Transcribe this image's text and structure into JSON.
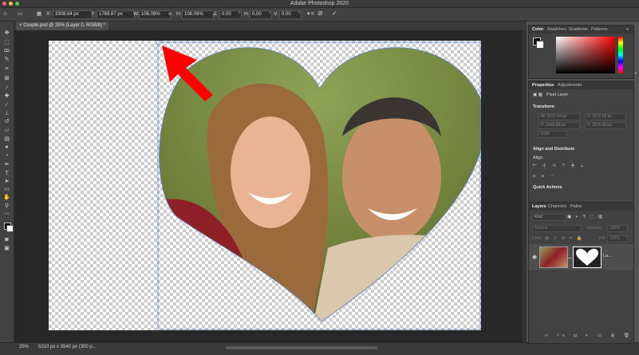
{
  "app": {
    "title": "Adobe Photoshop 2020"
  },
  "options_bar": {
    "x_label": "X:",
    "x_value": "3308.64 px",
    "y_label": "Y:",
    "y_value": "1769.87 px",
    "w_label": "W:",
    "w_value": "106.09%",
    "h_label": "H:",
    "h_value": "106.09%",
    "angle_value": "0.00",
    "hskew_label": "H:",
    "hskew_value": "0.00",
    "vskew_label": "V:",
    "vskew_value": "0.00",
    "degree_sym": "°",
    "cancel_glyph": "⊘",
    "commit_glyph": "✓"
  },
  "document_tab": {
    "label": "Couple.psd @ 25% (Layer 0, RGB/8) *",
    "close_glyph": "×"
  },
  "status_bar": {
    "zoom": "25%",
    "doc_info": "5310 px x 3540 px (300 p..."
  },
  "color_panel": {
    "tabs": [
      "Color",
      "Swatches",
      "Gradients",
      "Patterns"
    ],
    "foreground_color": "#000000",
    "background_color": "#ffffff"
  },
  "properties_panel": {
    "tabs": [
      "Properties",
      "Adjustments"
    ],
    "layer_type": "Pixel Layer",
    "transform_heading": "Transform",
    "w_placeholder": "W: 2372.94 px",
    "x_placeholder": "X: 3072.58 px",
    "h_placeholder": "H: 1649.80 px",
    "y_placeholder": "Y: 1574.49 px",
    "angle_placeholder": "0.00°",
    "align_heading": "Align and Distribute",
    "align_label": "Align:",
    "quick_actions_heading": "Quick Actions"
  },
  "layers_panel": {
    "tabs": [
      "Layers",
      "Channels",
      "Paths"
    ],
    "filter_label": "Kind",
    "blend_mode": "Normal",
    "opacity_label": "Opacity:",
    "opacity_value": "100%",
    "lock_label": "Lock:",
    "fill_label": "Fill:",
    "fill_value": "100%",
    "layer_name": "La..."
  },
  "icons": [
    "move-icon",
    "marquee-icon",
    "lasso-icon",
    "quick-select-icon",
    "crop-icon",
    "frame-icon",
    "eyedropper-icon",
    "healing-icon",
    "brush-icon",
    "stamp-icon",
    "history-brush-icon",
    "eraser-icon",
    "gradient-icon",
    "blur-icon",
    "dodge-icon",
    "pen-icon",
    "type-icon",
    "path-select-icon",
    "shape-icon",
    "hand-icon",
    "zoom-icon",
    "more-icon"
  ],
  "colors": {
    "accent_arrow": "#ff0000",
    "ui_dark": "#424242",
    "canvas_bg": "#282828"
  }
}
